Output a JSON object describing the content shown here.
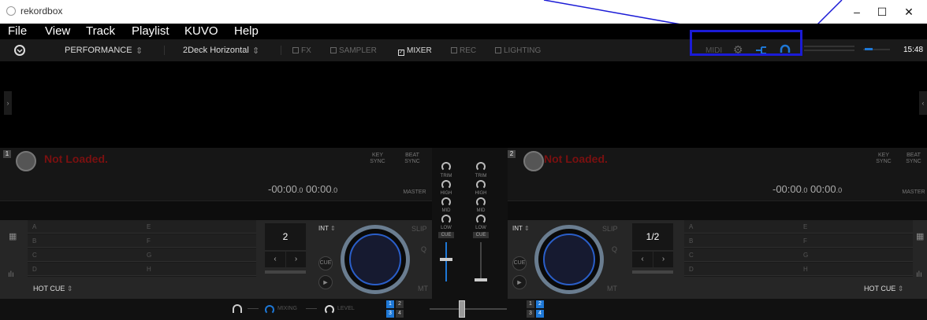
{
  "window": {
    "title": "rekordbox",
    "minimize": "–",
    "maximize": "☐",
    "close": "✕"
  },
  "menu": [
    "File",
    "View",
    "Track",
    "Playlist",
    "KUVO",
    "Help"
  ],
  "toolbar": {
    "mode": "PERFORMANCE",
    "layout": "2Deck Horizontal",
    "panels": [
      {
        "label": "FX",
        "checked": false
      },
      {
        "label": "SAMPLER",
        "checked": false
      },
      {
        "label": "MIXER",
        "checked": true
      },
      {
        "label": "REC",
        "checked": false
      },
      {
        "label": "LIGHTING",
        "checked": false
      }
    ],
    "midi": "MIDI",
    "clock": "15:48"
  },
  "decks": [
    {
      "number": "1",
      "status": "Not Loaded.",
      "time_remaining": "-00:00",
      "time_remaining_frac": ".0",
      "time_elapsed": "00:00",
      "time_elapsed_frac": ".0",
      "key_sync": "KEY SYNC",
      "beat_sync": "BEAT SYNC",
      "master": "MASTER",
      "pads_left": [
        "A",
        "B",
        "C",
        "D"
      ],
      "pads_right": [
        "E",
        "F",
        "G",
        "H"
      ],
      "pad_mode": "HOT CUE",
      "beat_value": "2",
      "int_label": "INT",
      "slip": "SLIP",
      "q": "Q",
      "mt": "MT",
      "cue": "CUE"
    },
    {
      "number": "2",
      "status": "Not Loaded.",
      "time_remaining": "-00:00",
      "time_remaining_frac": ".0",
      "time_elapsed": "00:00",
      "time_elapsed_frac": ".0",
      "key_sync": "KEY SYNC",
      "beat_sync": "BEAT SYNC",
      "master": "MASTER",
      "pads_left": [
        "A",
        "B",
        "C",
        "D"
      ],
      "pads_right": [
        "E",
        "F",
        "G",
        "H"
      ],
      "pad_mode": "HOT CUE",
      "beat_value": "1/2",
      "int_label": "INT",
      "slip": "SLIP",
      "q": "Q",
      "mt": "MT",
      "cue": "CUE"
    }
  ],
  "mixer": {
    "labels": [
      "TRIM",
      "HIGH",
      "MID",
      "LOW"
    ],
    "cue": "CUE"
  },
  "bottom": {
    "mixing": "MIXING",
    "level": "LEVEL",
    "deck_left": [
      "1",
      "2",
      "3",
      "4"
    ],
    "deck_right": [
      "1",
      "2",
      "3",
      "4"
    ]
  },
  "colors": {
    "accent": "#1e78d6",
    "annotation": "#1b1bd6",
    "not_loaded": "#7a1010"
  }
}
